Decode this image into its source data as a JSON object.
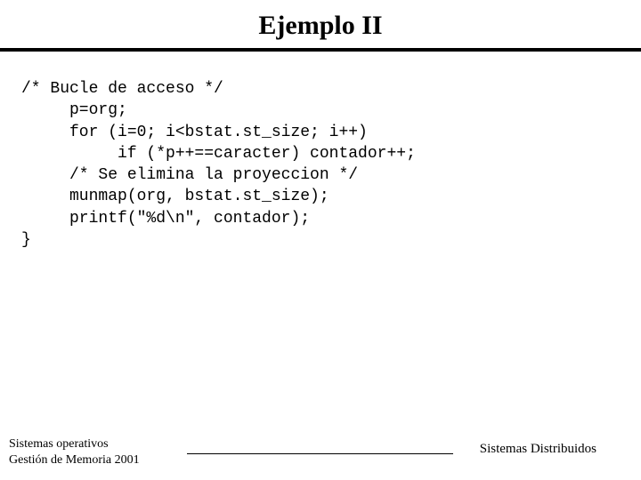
{
  "title": "Ejemplo II",
  "code": {
    "l1": "/* Bucle de acceso */",
    "l2": "     p=org;",
    "l3": "     for (i=0; i<bstat.st_size; i++)",
    "l4": "          if (*p++==caracter) contador++;",
    "l5": "     /* Se elimina la proyeccion */",
    "l6": "     munmap(org, bstat.st_size);",
    "l7": "     printf(\"%d\\n\", contador);",
    "l8": "}"
  },
  "footer": {
    "left_line1": "Sistemas operativos",
    "left_line2": "Gestión de Memoria 2001",
    "right": "Sistemas Distribuidos"
  }
}
